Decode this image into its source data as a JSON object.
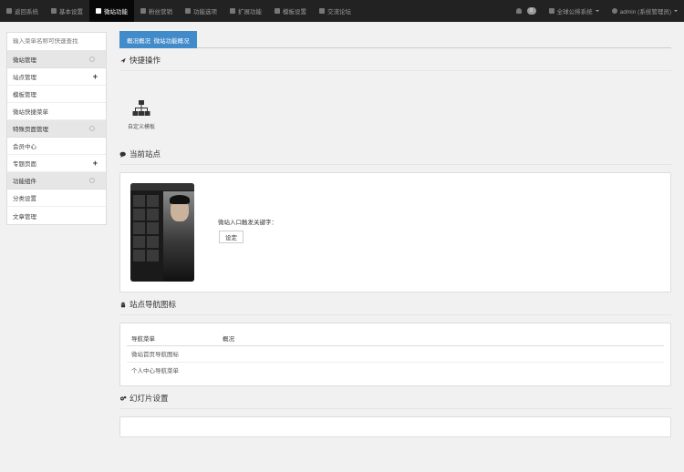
{
  "topnav": {
    "items": [
      {
        "label": "返回系统",
        "icon": "return-icon"
      },
      {
        "label": "基本设置",
        "icon": "gear-icon"
      },
      {
        "label": "微站功能",
        "icon": "grid-icon"
      },
      {
        "label": "粉丝营销",
        "icon": "megaphone-icon"
      },
      {
        "label": "功能选项",
        "icon": "tool-icon"
      },
      {
        "label": "扩展功能",
        "icon": "puzzle-icon"
      },
      {
        "label": "模板设置",
        "icon": "template-icon"
      },
      {
        "label": "交流论坛",
        "icon": "chat-icon"
      }
    ],
    "active_index": 2,
    "notify_count": "0",
    "public_account": "全球公排系统",
    "user": "admin (系统管理员)"
  },
  "sidebar": {
    "search_placeholder": "输入菜单名称可快速查找",
    "sections": [
      {
        "title": "微站管理",
        "items": [
          {
            "label": "站点管理",
            "plus": true
          },
          {
            "label": "模板管理",
            "plus": false
          },
          {
            "label": "微站快捷菜单",
            "plus": false
          }
        ]
      },
      {
        "title": "特殊页面管理",
        "items": [
          {
            "label": "会员中心",
            "plus": false
          },
          {
            "label": "专题页面",
            "plus": true
          }
        ]
      },
      {
        "title": "功能组件",
        "items": [
          {
            "label": "分类设置",
            "plus": false
          },
          {
            "label": "文章管理",
            "plus": false
          }
        ]
      }
    ]
  },
  "main": {
    "tabs": [
      "概况概况",
      "微站功能概况"
    ],
    "quick": {
      "title": "快捷操作",
      "action": "自定义模板"
    },
    "site": {
      "title": "当前站点",
      "keyword_label": "微站入口触发关键字：",
      "button": "设定"
    },
    "nav": {
      "title": "站点导航图标",
      "col1": "导航菜单",
      "col2": "概况",
      "rows": [
        "微站首页导航图标",
        "个人中心导航菜单"
      ]
    },
    "slides": {
      "title": "幻灯片设置"
    }
  }
}
